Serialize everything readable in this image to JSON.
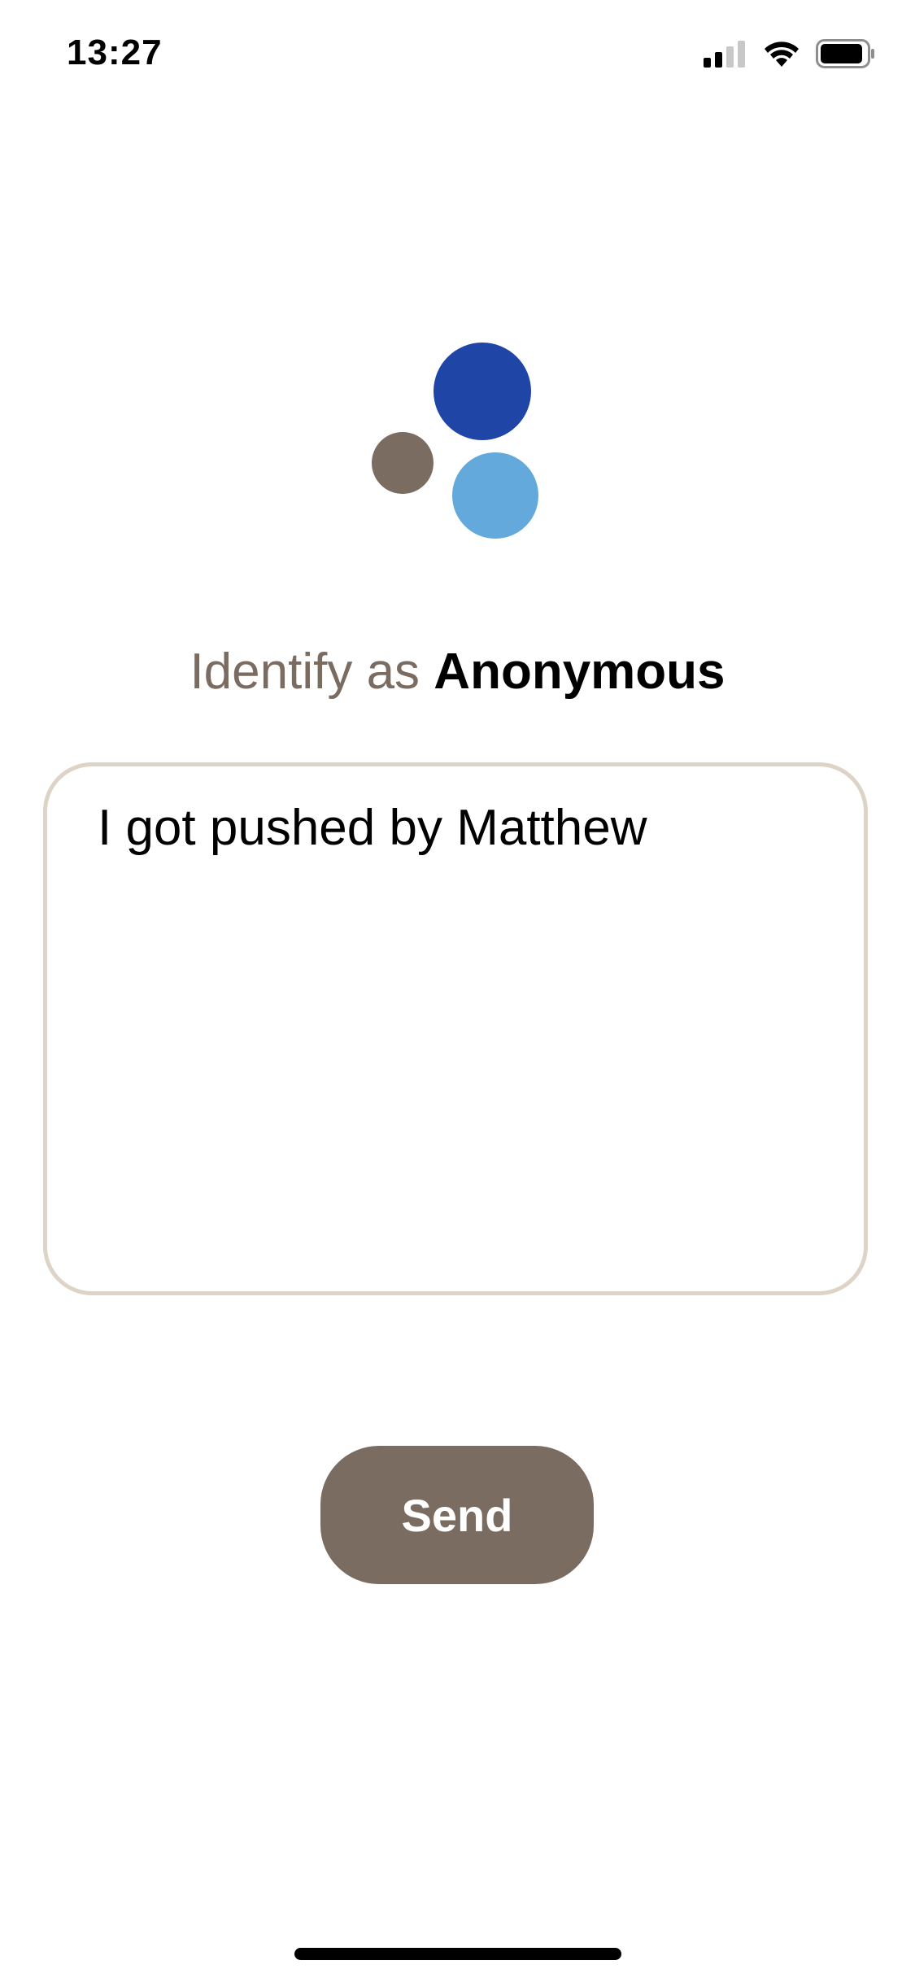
{
  "status_bar": {
    "time": "13:27"
  },
  "icons": {
    "signal": "cellular-signal-icon",
    "wifi": "wifi-icon",
    "battery": "battery-icon"
  },
  "logo": {
    "colors": {
      "dark_blue": "#1f45a7",
      "light_blue": "#64a9db",
      "taupe": "#7a6c60"
    }
  },
  "identify": {
    "prefix": "Identify as",
    "name": "Anonymous"
  },
  "message": {
    "value": "I got pushed by Matthew"
  },
  "send_button": {
    "label": "Send"
  },
  "colors": {
    "accent": "#7a6c60",
    "box_border": "#ddd3c6",
    "background": "#ffffff"
  }
}
